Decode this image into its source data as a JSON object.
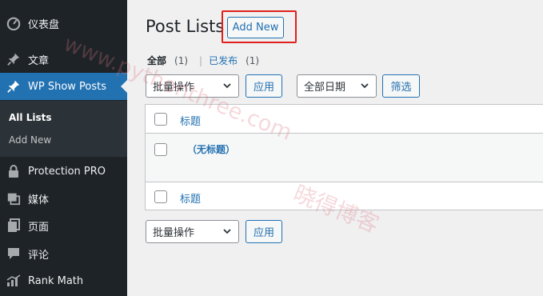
{
  "sidebar": {
    "items": [
      {
        "label": "仪表盘",
        "icon": "dashboard-icon"
      },
      {
        "label": "文章",
        "icon": "pin-icon"
      },
      {
        "label": "WP Show Posts",
        "icon": "pin-icon",
        "active": true
      },
      {
        "label": "Protection PRO",
        "icon": "lock-icon"
      },
      {
        "label": "媒体",
        "icon": "media-icon"
      },
      {
        "label": "页面",
        "icon": "page-icon"
      },
      {
        "label": "评论",
        "icon": "comment-icon"
      },
      {
        "label": "Rank Math",
        "icon": "chart-icon"
      }
    ],
    "submenu": [
      {
        "label": "All Lists",
        "current": true
      },
      {
        "label": "Add New",
        "current": false
      }
    ]
  },
  "main": {
    "title": "Post Lists",
    "add_new_label": "Add New",
    "filters": {
      "all_label": "全部",
      "all_count": "(1)",
      "separator": "|",
      "published_label": "已发布",
      "published_count": "(1)"
    },
    "bulk_top": {
      "selected": "批量操作",
      "apply_label": "应用"
    },
    "date_filter": {
      "selected": "全部日期",
      "filter_label": "筛选"
    },
    "table": {
      "header_title": "标题",
      "rows": [
        {
          "title": "（无标题）"
        }
      ],
      "footer_title": "标题"
    },
    "bulk_bottom": {
      "selected": "批量操作",
      "apply_label": "应用"
    }
  },
  "watermark": {
    "line1": "www.pythonthree.com",
    "line2": "晓得博客"
  },
  "colors": {
    "sidebar_bg": "#1d2327",
    "active_bg": "#2271b1",
    "link": "#2271b1",
    "highlight_box": "#e0201b"
  }
}
